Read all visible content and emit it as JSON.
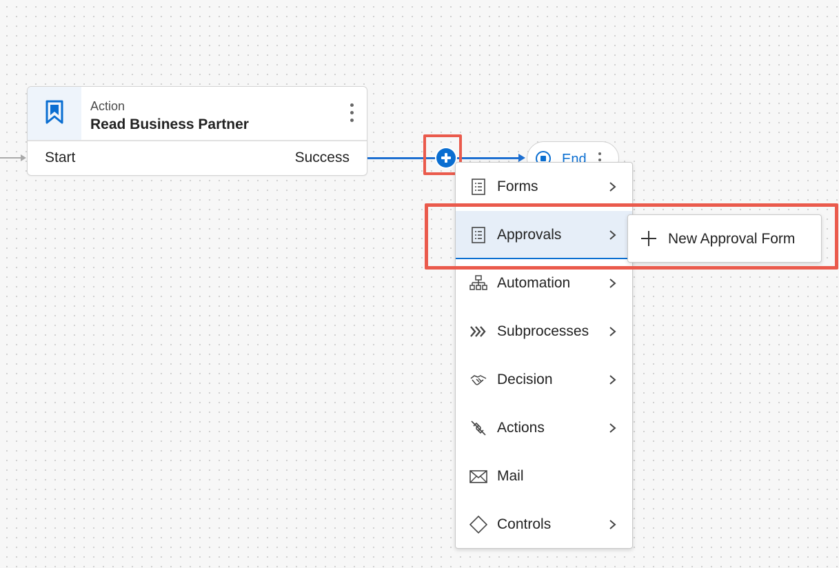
{
  "action_card": {
    "type_label": "Action",
    "title": "Read Business Partner",
    "start_label": "Start",
    "success_label": "Success",
    "icon": "bookmark-icon"
  },
  "end_node": {
    "label": "End",
    "icon": "stop-circle-icon"
  },
  "menu": {
    "items": [
      {
        "label": "Forms",
        "icon": "form-icon",
        "has_submenu": true
      },
      {
        "label": "Approvals",
        "icon": "form-icon",
        "has_submenu": true,
        "selected": true
      },
      {
        "label": "Automation",
        "icon": "hierarchy-icon",
        "has_submenu": true
      },
      {
        "label": "Subprocesses",
        "icon": "chevrons-icon",
        "has_submenu": true
      },
      {
        "label": "Decision",
        "icon": "handshake-icon",
        "has_submenu": true
      },
      {
        "label": "Actions",
        "icon": "unlink-icon",
        "has_submenu": true
      },
      {
        "label": "Mail",
        "icon": "envelope-icon",
        "has_submenu": false
      },
      {
        "label": "Controls",
        "icon": "diamond-icon",
        "has_submenu": true
      }
    ]
  },
  "submenu": {
    "new_label": "New Approval Form",
    "icon": "plus-icon"
  },
  "colors": {
    "accent": "#0a6ed1",
    "highlight": "#ea5a4c",
    "selected_bg": "#e6eef8"
  }
}
